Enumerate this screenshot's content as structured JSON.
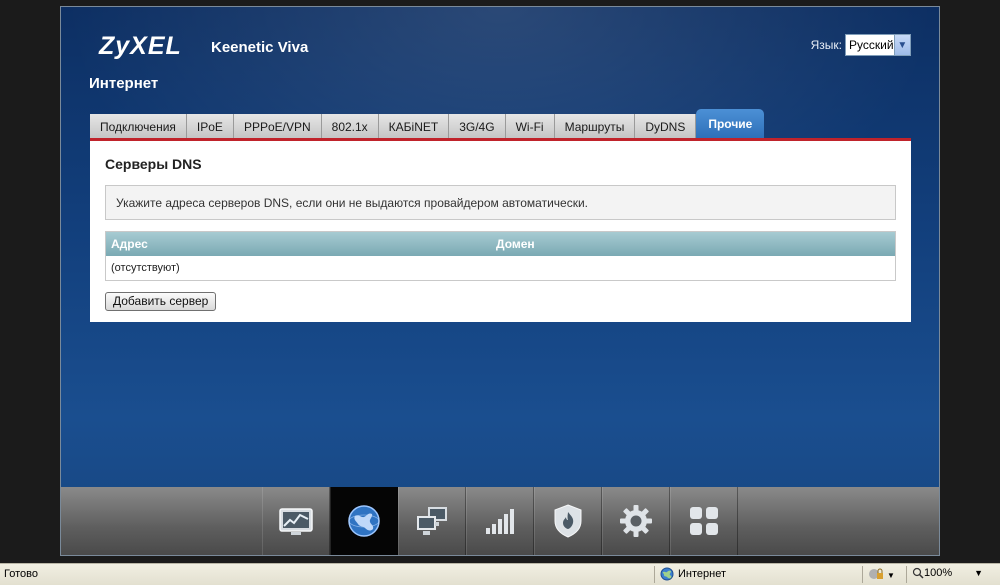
{
  "header": {
    "brand": "ZyXEL",
    "model": "Keenetic Viva",
    "page_title": "Интернет",
    "language_label": "Язык:",
    "language_value": "Русский"
  },
  "tabs": [
    {
      "label": "Подключения",
      "active": false
    },
    {
      "label": "IPoE",
      "active": false
    },
    {
      "label": "PPPoE/VPN",
      "active": false
    },
    {
      "label": "802.1x",
      "active": false
    },
    {
      "label": "КАБiNET",
      "active": false
    },
    {
      "label": "3G/4G",
      "active": false
    },
    {
      "label": "Wi-Fi",
      "active": false
    },
    {
      "label": "Маршруты",
      "active": false
    },
    {
      "label": "DyDNS",
      "active": false
    },
    {
      "label": "Прочие",
      "active": true
    }
  ],
  "panel": {
    "title": "Серверы DNS",
    "info": "Укажите адреса серверов DNS, если они не выдаются провайдером автоматически.",
    "columns": [
      "Адрес",
      "Домен"
    ],
    "empty_row": "(отсутствуют)",
    "add_button": "Добавить сервер"
  },
  "dock": [
    {
      "icon": "monitor-chart-icon",
      "active": false
    },
    {
      "icon": "globe-icon",
      "active": true
    },
    {
      "icon": "network-computers-icon",
      "active": false
    },
    {
      "icon": "signal-bars-icon",
      "active": false
    },
    {
      "icon": "shield-flame-icon",
      "active": false
    },
    {
      "icon": "gear-icon",
      "active": false
    },
    {
      "icon": "apps-grid-icon",
      "active": false
    }
  ],
  "statusbar": {
    "left": "Готово",
    "zone": "Интернет",
    "zoom": "100%"
  },
  "colors": {
    "accent_red": "#c0232b",
    "active_tab": "#2d6fb8",
    "table_header": "#7aa9b3"
  }
}
